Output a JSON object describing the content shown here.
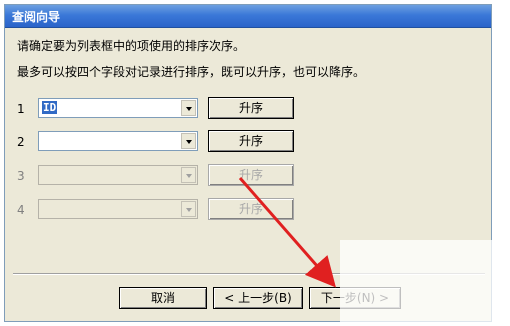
{
  "window": {
    "title": "查阅向导"
  },
  "instructions": {
    "line1": "请确定要为列表框中的项使用的排序次序。",
    "line2": "最多可以按四个字段对记录进行排序，既可以升序，也可以降序。"
  },
  "rows": [
    {
      "number": "1",
      "field_value": "ID",
      "button": "升序",
      "enabled": true
    },
    {
      "number": "2",
      "field_value": "",
      "button": "升序",
      "enabled": true
    },
    {
      "number": "3",
      "field_value": "",
      "button": "升序",
      "enabled": false
    },
    {
      "number": "4",
      "field_value": "",
      "button": "升序",
      "enabled": false
    }
  ],
  "buttons": {
    "cancel": "取消",
    "back": "< 上一步(B)",
    "next": "下一步(N) >"
  },
  "annotation": {
    "arrow_color": "#e02020"
  }
}
